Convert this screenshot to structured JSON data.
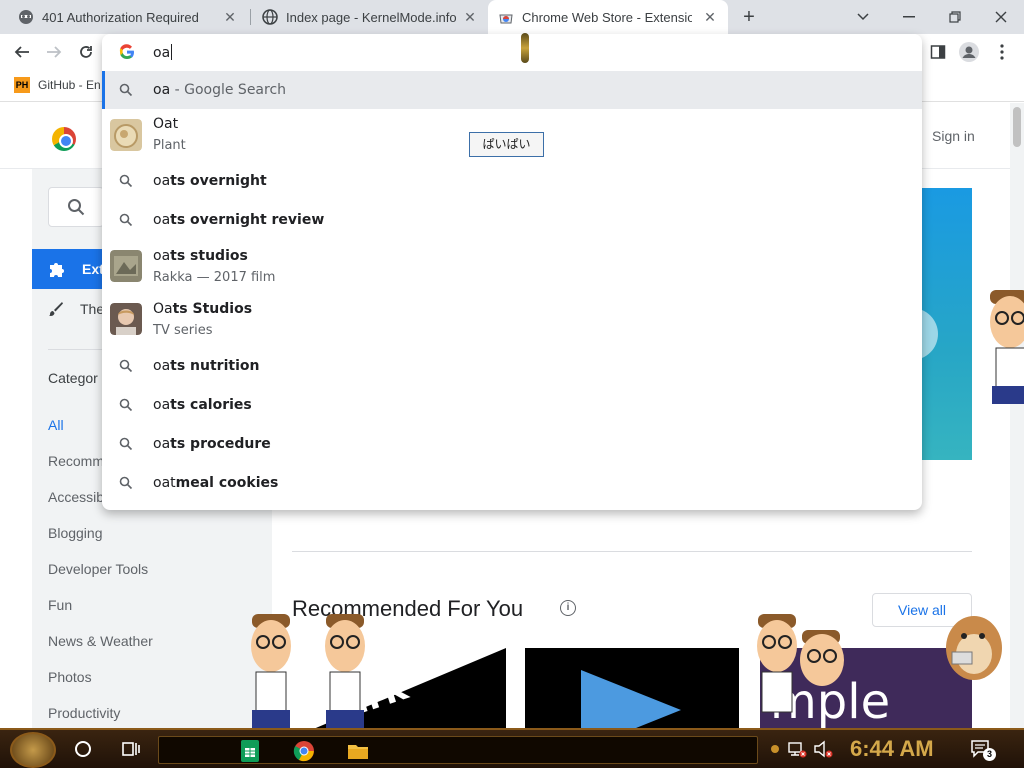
{
  "tabs": [
    {
      "title": "401 Authorization Required",
      "icon": "spy-icon"
    },
    {
      "title": "Index page - KernelMode.info",
      "icon": "globe-icon"
    },
    {
      "title": "Chrome Web Store - Extensions",
      "icon": "chrome-web-store-icon",
      "active": true
    }
  ],
  "omnibox": {
    "typed": "oa"
  },
  "bookmarks": [
    {
      "label": "GitHub - En",
      "badge": "PH"
    }
  ],
  "suggestions": [
    {
      "kind": "search",
      "bold": "",
      "plain": "oa",
      "suffix": " - Google Search",
      "highlighted": true
    },
    {
      "kind": "entity",
      "plain": "Oat",
      "sub": "Plant"
    },
    {
      "kind": "search",
      "plain": "oa",
      "bold": "ts overnight"
    },
    {
      "kind": "search",
      "plain": "oa",
      "bold": "ts overnight review"
    },
    {
      "kind": "entity",
      "plain": "oa",
      "bold": "ts studios",
      "sub": "Rakka — 2017 film"
    },
    {
      "kind": "entity",
      "plain": "Oa",
      "bold": "ts Studios",
      "sub": "TV series"
    },
    {
      "kind": "search",
      "plain": "oa",
      "bold": "ts nutrition"
    },
    {
      "kind": "search",
      "plain": "oa",
      "bold": "ts calories"
    },
    {
      "kind": "search",
      "plain": "oa",
      "bold": "ts procedure"
    },
    {
      "kind": "search",
      "plain": "oat",
      "bold": "meal cookies"
    }
  ],
  "ime": "ぱいぱい",
  "page": {
    "signin": "Sign in",
    "sidebar": {
      "extensions_label": "Ext",
      "themes_label": "The",
      "categories_heading": "Categor",
      "categories": [
        "All",
        "Recomm",
        "Accessib",
        "Blogging",
        "Developer Tools",
        "Fun",
        "News & Weather",
        "Photos",
        "Productivity"
      ]
    },
    "recommended_title": "Recommended For You",
    "view_all": "View all",
    "card_texts": [
      "ark",
      "mple"
    ]
  },
  "taskbar": {
    "clock": "6:44 AM",
    "notification_count": "3"
  }
}
